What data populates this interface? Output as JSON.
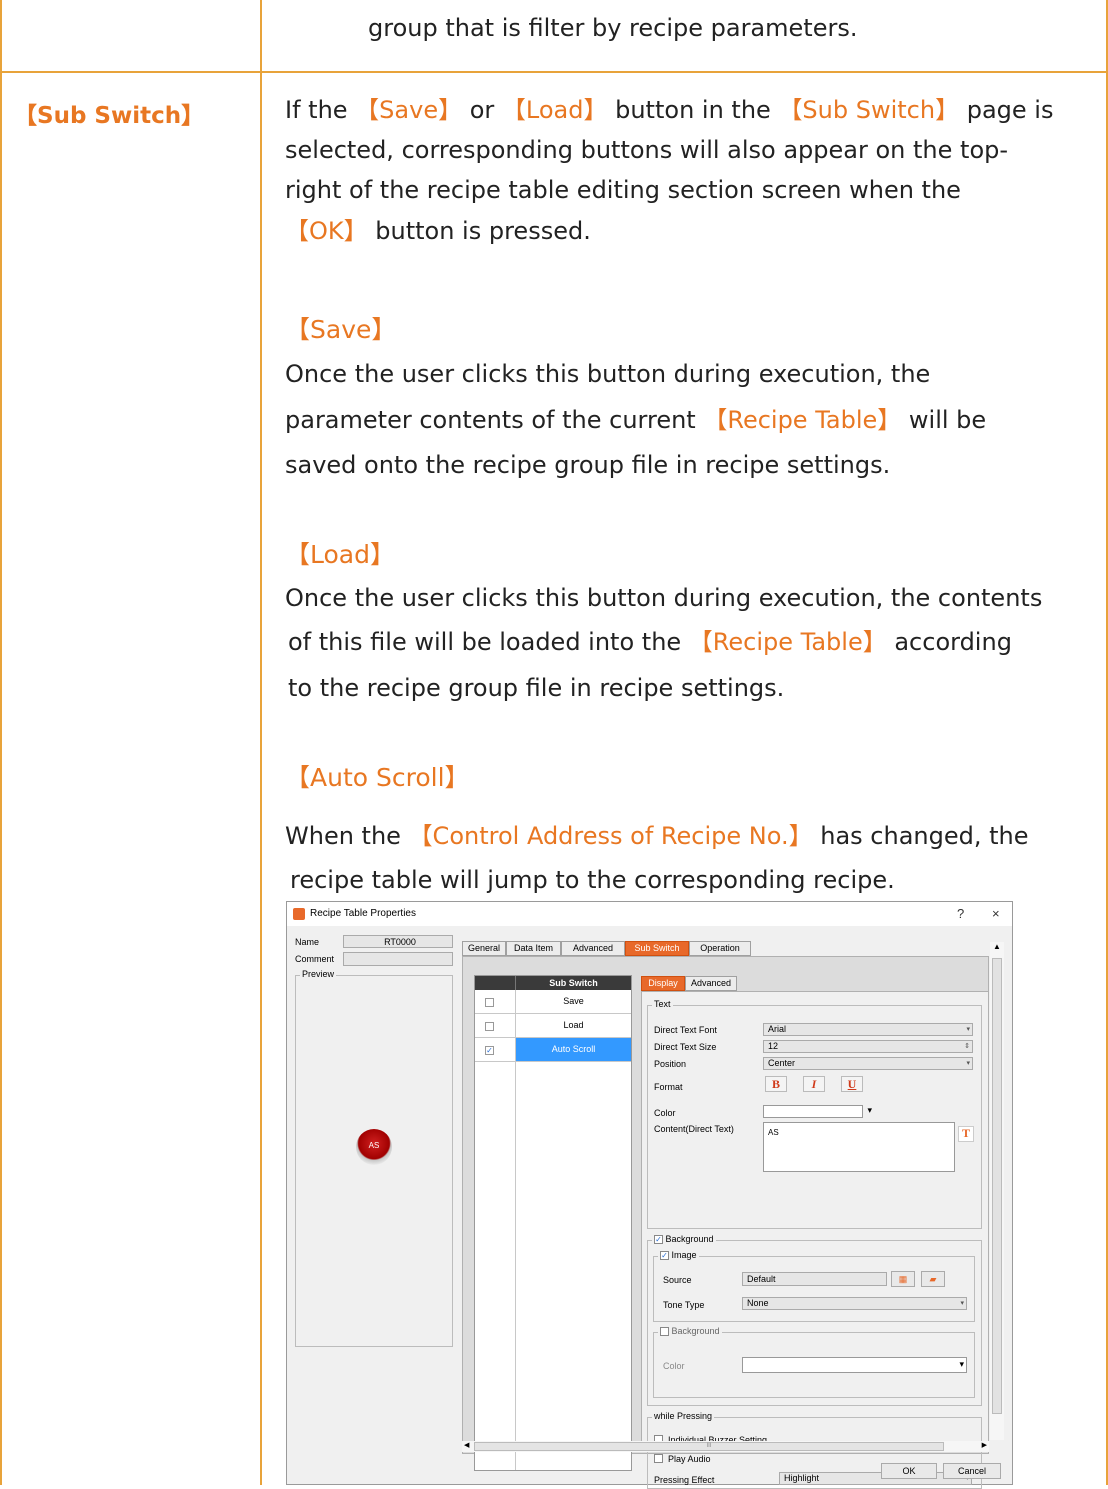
{
  "top_row": {
    "text": "group that is filter by recipe parameters."
  },
  "sub_switch_row": {
    "label": "【Sub Switch】",
    "intro": {
      "p1a": "If the ",
      "save": "【Save】",
      "p1b": " or ",
      "load": "【Load】",
      "p1c": " button in the ",
      "subswitch": "【Sub Switch】",
      "p1d": " page is",
      "line2": "selected, corresponding buttons will also appear on the top-",
      "line3": "right of the recipe table editing section screen when the",
      "ok": "【OK】",
      "line4": " button is pressed."
    },
    "save_section": {
      "heading": "【Save】",
      "line1": "Once the user clicks this button during execution, the",
      "line2a": "parameter contents of the current ",
      "recipe_table": "【Recipe Table】",
      "line2b": " will be",
      "line3": "saved onto the recipe group file in recipe settings."
    },
    "load_section": {
      "heading": "【Load】",
      "line1": "Once the user clicks this button during execution, the contents",
      "line2a": "of this file will be loaded into the ",
      "recipe_table": "【Recipe Table】",
      "line2b": " according",
      "line3": "to the recipe group file in recipe settings."
    },
    "auto_scroll_section": {
      "heading": "【Auto Scroll】",
      "line1a": "When the ",
      "control": "【Control Address of Recipe No.】",
      "line1b": " has changed, the",
      "line2": "recipe table will jump to the corresponding recipe."
    }
  },
  "dialog": {
    "title": "Recipe Table Properties",
    "help": "?",
    "close": "×",
    "name_label": "Name",
    "name_value": "RT0000",
    "comment_label": "Comment",
    "preview_label": "Preview",
    "preview_button_text": "AS",
    "tabs": [
      "General",
      "Data Item",
      "Advanced",
      "Sub Switch",
      "Operation"
    ],
    "sub_switch_header": "Sub Switch",
    "switch_items": [
      {
        "label": "Save",
        "checked": false
      },
      {
        "label": "Load",
        "checked": false
      },
      {
        "label": "Auto Scroll",
        "checked": true
      }
    ],
    "inner_tabs": [
      "Display",
      "Advanced"
    ],
    "text_group": "Text",
    "direct_text_font_label": "Direct Text Font",
    "direct_text_font_value": "Arial",
    "direct_text_size_label": "Direct Text Size",
    "direct_text_size_value": "12",
    "position_label": "Position",
    "position_value": "Center",
    "format_label": "Format",
    "format_buttons": [
      "B",
      "I",
      "U"
    ],
    "color_label": "Color",
    "content_label": "Content(Direct Text)",
    "content_value": "AS",
    "background_group": "Background",
    "image_group": "Image",
    "source_label": "Source",
    "source_value": "Default",
    "tone_type_label": "Tone Type",
    "tone_type_value": "None",
    "bg_sub_group": "Background",
    "bg_color_label": "Color",
    "while_pressing_group": "while Pressing",
    "individual_buzzer": "Individual Buzzer Setting",
    "play_audio": "Play Audio",
    "pressing_effect_label": "Pressing Effect",
    "pressing_effect_value": "Highlight",
    "scroll_mark": "III",
    "ok_button": "OK",
    "cancel_button": "Cancel",
    "accent_color": "#e8692a",
    "selection_color": "#3399ff"
  }
}
